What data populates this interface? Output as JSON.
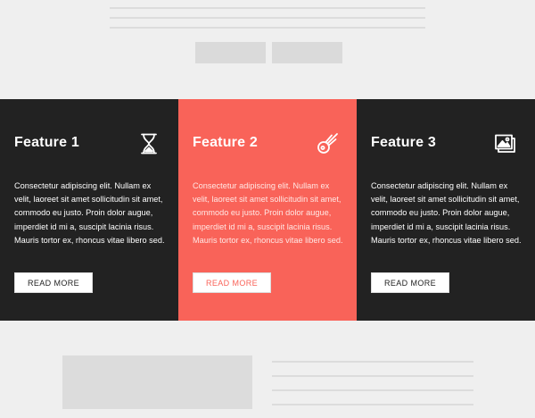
{
  "colors": {
    "background": "#efefef",
    "dark_panel": "#222222",
    "accent_panel": "#f96359",
    "placeholder": "#dcdcdc"
  },
  "features": [
    {
      "title": "Feature 1",
      "icon": "hourglass-icon",
      "body": "Consectetur adipiscing elit. Nullam ex velit, laoreet sit amet sollicitudin sit amet, commodo eu justo. Proin dolor augue, imperdiet id mi a, suscipit lacinia risus. Mauris tortor ex, rhoncus vitae libero sed.",
      "button": "READ MORE"
    },
    {
      "title": "Feature 2",
      "icon": "comet-icon",
      "body": "Consectetur adipiscing elit. Nullam ex velit, laoreet sit amet sollicitudin sit amet, commodo eu justo. Proin dolor augue, imperdiet id mi a, suscipit lacinia risus. Mauris tortor ex, rhoncus vitae libero sed.",
      "button": "READ MORE"
    },
    {
      "title": "Feature 3",
      "icon": "photos-icon",
      "body": "Consectetur adipiscing elit. Nullam ex velit, laoreet sit amet sollicitudin sit amet, commodo eu justo. Proin dolor augue, imperdiet id mi a, suscipit lacinia risus. Mauris tortor ex, rhoncus vitae libero sed.",
      "button": "READ MORE"
    }
  ]
}
